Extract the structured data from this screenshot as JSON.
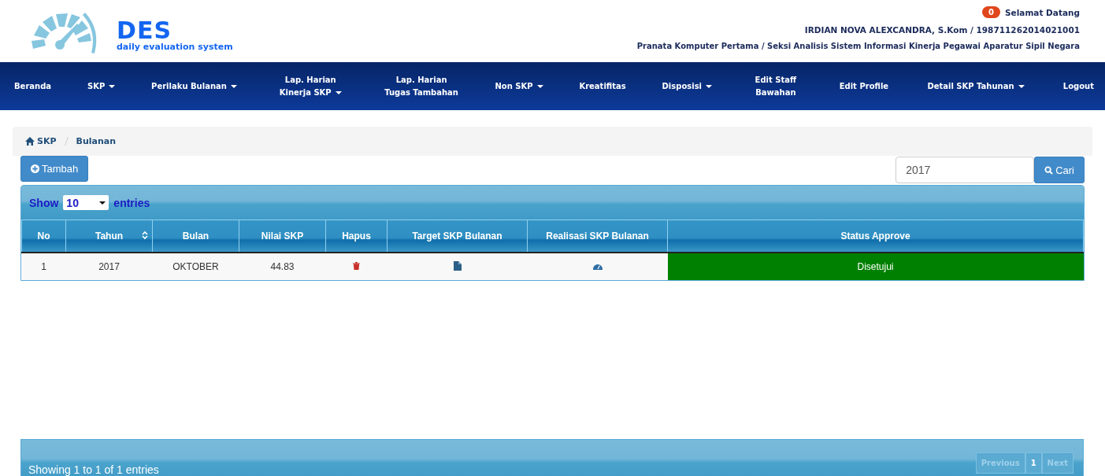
{
  "logo": {
    "title": "DES",
    "subtitle": "daily evaluation system"
  },
  "user": {
    "badge": "0",
    "greeting": "Selamat Datang",
    "name": "IRDIAN NOVA ALEXCANDRA, S.Kom / 198711262014021001",
    "position": "Pranata Komputer Pertama / Seksi Analisis Sistem Informasi Kinerja Pegawai Aparatur Sipil Negara"
  },
  "nav": [
    {
      "label": "Beranda",
      "dropdown": false
    },
    {
      "label": "SKP",
      "dropdown": true
    },
    {
      "label": "Perilaku Bulanan",
      "dropdown": true
    },
    {
      "label": "Lap. Harian Kinerja SKP",
      "dropdown": true
    },
    {
      "label": "Lap. Harian Tugas Tambahan",
      "dropdown": false
    },
    {
      "label": "Non SKP",
      "dropdown": true
    },
    {
      "label": "Kreatifitas",
      "dropdown": false
    },
    {
      "label": "Disposisi",
      "dropdown": true
    },
    {
      "label": "Edit Staff Bawahan",
      "dropdown": false
    },
    {
      "label": "Edit Profile",
      "dropdown": false
    },
    {
      "label": "Detail SKP Tahunan",
      "dropdown": true
    },
    {
      "label": "Logout",
      "dropdown": false
    }
  ],
  "breadcrumb": [
    "SKP",
    "Bulanan"
  ],
  "add_button": "Tambah",
  "search": {
    "value": "2017",
    "button": "Cari"
  },
  "table": {
    "show_label": "Show",
    "page_size": "10",
    "entries_label": "entries",
    "columns": [
      {
        "label": "No",
        "sortable": false
      },
      {
        "label": "Tahun",
        "sortable": true
      },
      {
        "label": "Bulan",
        "sortable": false
      },
      {
        "label": "Nilai SKP",
        "sortable": false
      },
      {
        "label": "Hapus",
        "sortable": false
      },
      {
        "label": "Target SKP Bulanan",
        "sortable": false
      },
      {
        "label": "Realisasi SKP Bulanan",
        "sortable": false
      },
      {
        "label": "Status Approve",
        "sortable": false
      }
    ],
    "rows": [
      {
        "no": "1",
        "tahun": "2017",
        "bulan": "OKTOBER",
        "nilai": "44.83",
        "status": "Disetujui",
        "color": "#008000"
      }
    ],
    "info": "Showing 1 to 1 of 1 entries",
    "pagination": [
      {
        "label": "Previous",
        "disabled": true
      },
      {
        "label": "1",
        "disabled": false
      },
      {
        "label": "Next",
        "disabled": true
      }
    ]
  }
}
